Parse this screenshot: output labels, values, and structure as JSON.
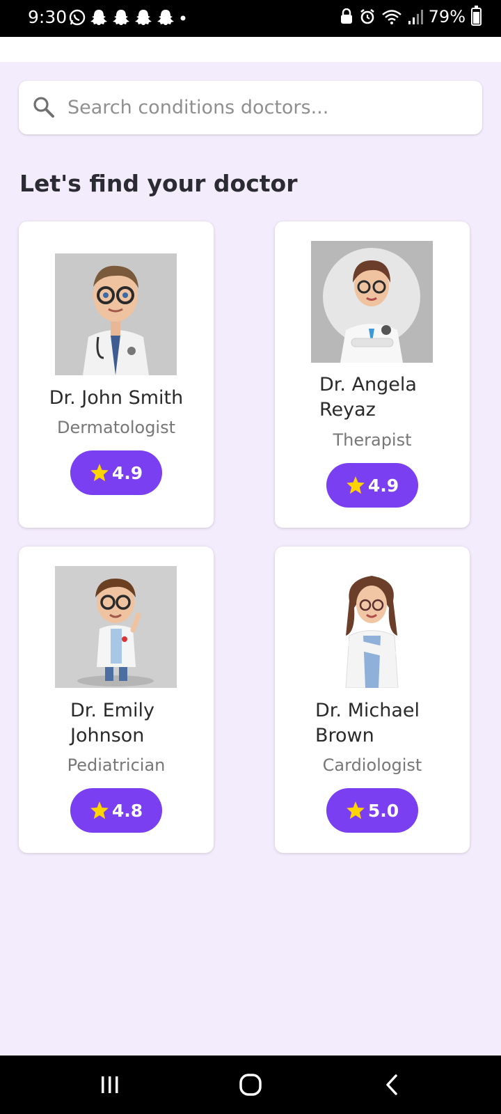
{
  "status_bar": {
    "time": "9:30",
    "battery_text": "79%",
    "battery_level": 0.79,
    "icons": [
      "whatsapp-icon",
      "snapchat-icon",
      "snapchat-icon",
      "snapchat-icon",
      "snapchat-icon",
      "dot-icon",
      "lock-icon",
      "alarm-icon",
      "wifi-icon",
      "signal-icon",
      "battery-icon"
    ]
  },
  "search": {
    "placeholder": "Search conditions doctors..."
  },
  "heading": "Let's find your doctor",
  "doctors": [
    {
      "name_line1": "Dr. John Smith",
      "name_line2": "",
      "specialty": "Dermatologist",
      "rating": "4.9"
    },
    {
      "name_line1": "Dr. Angela",
      "name_line2": "Reyaz",
      "specialty": "Therapist",
      "rating": "4.9"
    },
    {
      "name_line1": "Dr. Emily",
      "name_line2": "Johnson",
      "specialty": "Pediatrician",
      "rating": "4.8"
    },
    {
      "name_line1": "Dr. Michael",
      "name_line2": "Brown",
      "specialty": "Cardiologist",
      "rating": "5.0"
    }
  ],
  "colors": {
    "background": "#f3ecfd",
    "accent": "#7b3ff2",
    "star": "#ffd400"
  },
  "nav_icons": [
    "recents-icon",
    "home-icon",
    "back-icon"
  ]
}
